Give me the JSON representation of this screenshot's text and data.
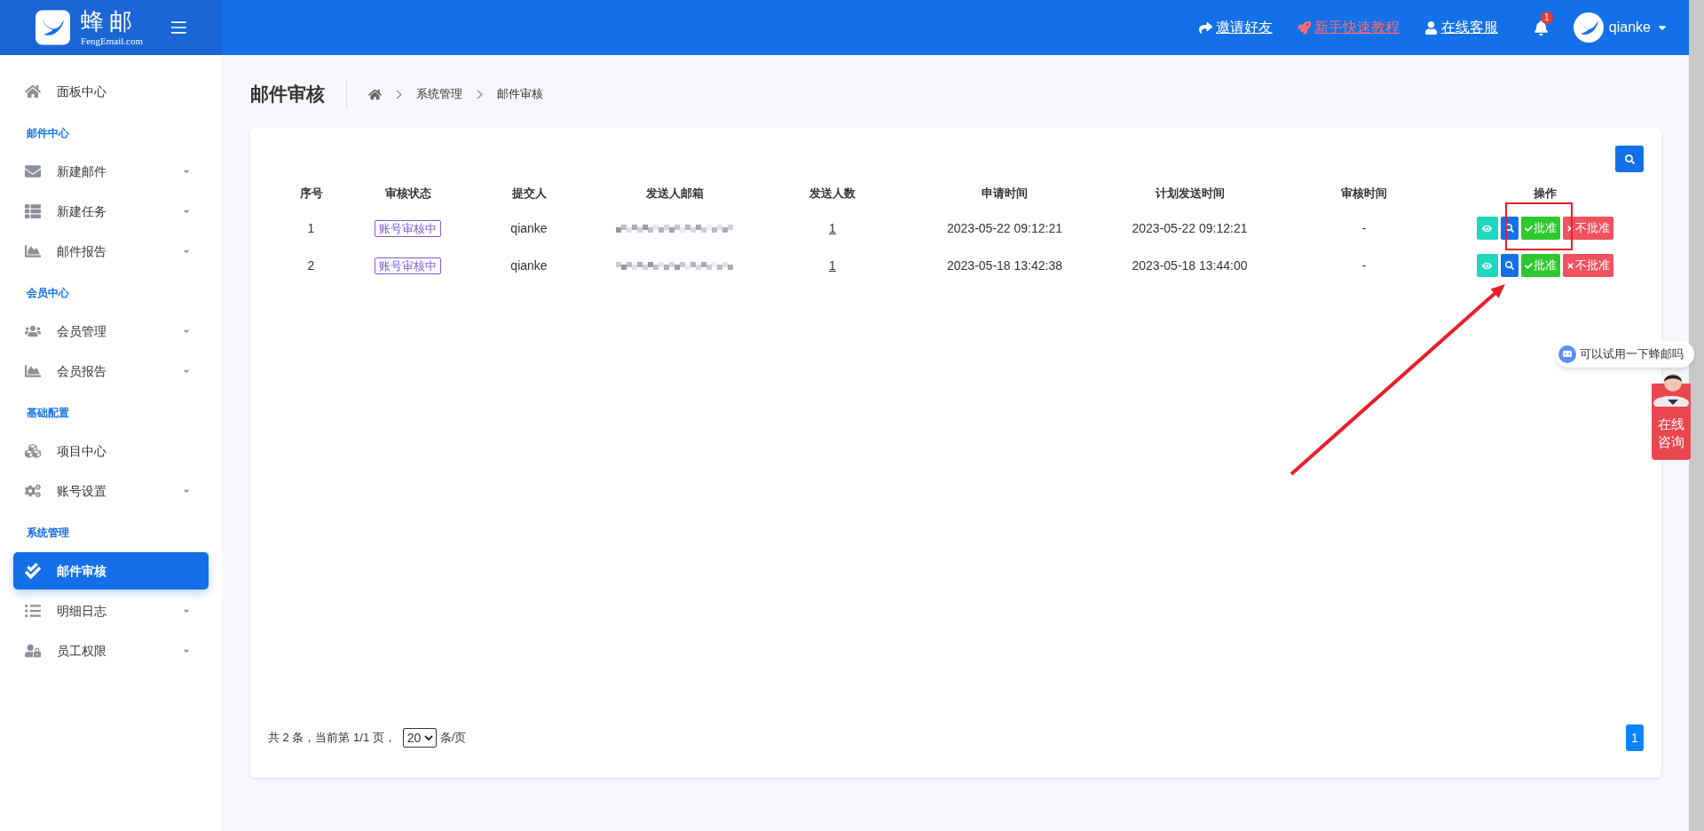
{
  "header": {
    "logo_text": "蜂邮",
    "logo_sub": "FengEmail.com",
    "links": [
      {
        "label": "邀请好友",
        "kind": "share"
      },
      {
        "label": "新手快速教程",
        "kind": "rocket"
      },
      {
        "label": "在线客服",
        "kind": "user"
      }
    ],
    "notifications": "1",
    "user": "qianke"
  },
  "sidebar": {
    "items": [
      {
        "kind": "item",
        "label": "面板中心",
        "selected": false,
        "expandable": false
      },
      {
        "kind": "section",
        "label": "邮件中心"
      },
      {
        "kind": "item",
        "label": "新建邮件",
        "selected": false,
        "expandable": true
      },
      {
        "kind": "item",
        "label": "新建任务",
        "selected": false,
        "expandable": true
      },
      {
        "kind": "item",
        "label": "邮件报告",
        "selected": false,
        "expandable": true
      },
      {
        "kind": "section",
        "label": "会员中心"
      },
      {
        "kind": "item",
        "label": "会员管理",
        "selected": false,
        "expandable": true
      },
      {
        "kind": "item",
        "label": "会员报告",
        "selected": false,
        "expandable": true
      },
      {
        "kind": "section",
        "label": "基础配置"
      },
      {
        "kind": "item",
        "label": "项目中心",
        "selected": false,
        "expandable": false
      },
      {
        "kind": "item",
        "label": "账号设置",
        "selected": false,
        "expandable": true
      },
      {
        "kind": "section",
        "label": "系统管理"
      },
      {
        "kind": "item",
        "label": "邮件审核",
        "selected": true,
        "expandable": false
      },
      {
        "kind": "item",
        "label": "明细日志",
        "selected": false,
        "expandable": true
      },
      {
        "kind": "item",
        "label": "员工权限",
        "selected": false,
        "expandable": true
      }
    ]
  },
  "page": {
    "title": "邮件审核",
    "breadcrumb": [
      "系统管理",
      "邮件审核"
    ]
  },
  "table": {
    "columns": [
      "序号",
      "审核状态",
      "提交人",
      "发送人邮箱",
      "发送人数",
      "申请时间",
      "计划发送时间",
      "审核时间",
      "操作"
    ],
    "rows": [
      {
        "index": "1",
        "status": "账号审核中",
        "submitter": "qianke",
        "count": "1",
        "applied": "2023-05-22 09:12:21",
        "scheduled": "2023-05-22 09:12:21",
        "reviewed": "-",
        "approve": "批准",
        "reject": "不批准"
      },
      {
        "index": "2",
        "status": "账号审核中",
        "submitter": "qianke",
        "count": "1",
        "applied": "2023-05-18 13:42:38",
        "scheduled": "2023-05-18 13:44:00",
        "reviewed": "-",
        "approve": "批准",
        "reject": "不批准"
      }
    ]
  },
  "pagination": {
    "summary": "共 2 条，当前第 1/1 页，",
    "page_size": "20",
    "per_page": "条/页",
    "pages": [
      {
        "label": "1",
        "selected": true
      }
    ]
  },
  "chat": {
    "bubble": "可以试用一下蜂邮吗",
    "consult": "在线咨询"
  }
}
